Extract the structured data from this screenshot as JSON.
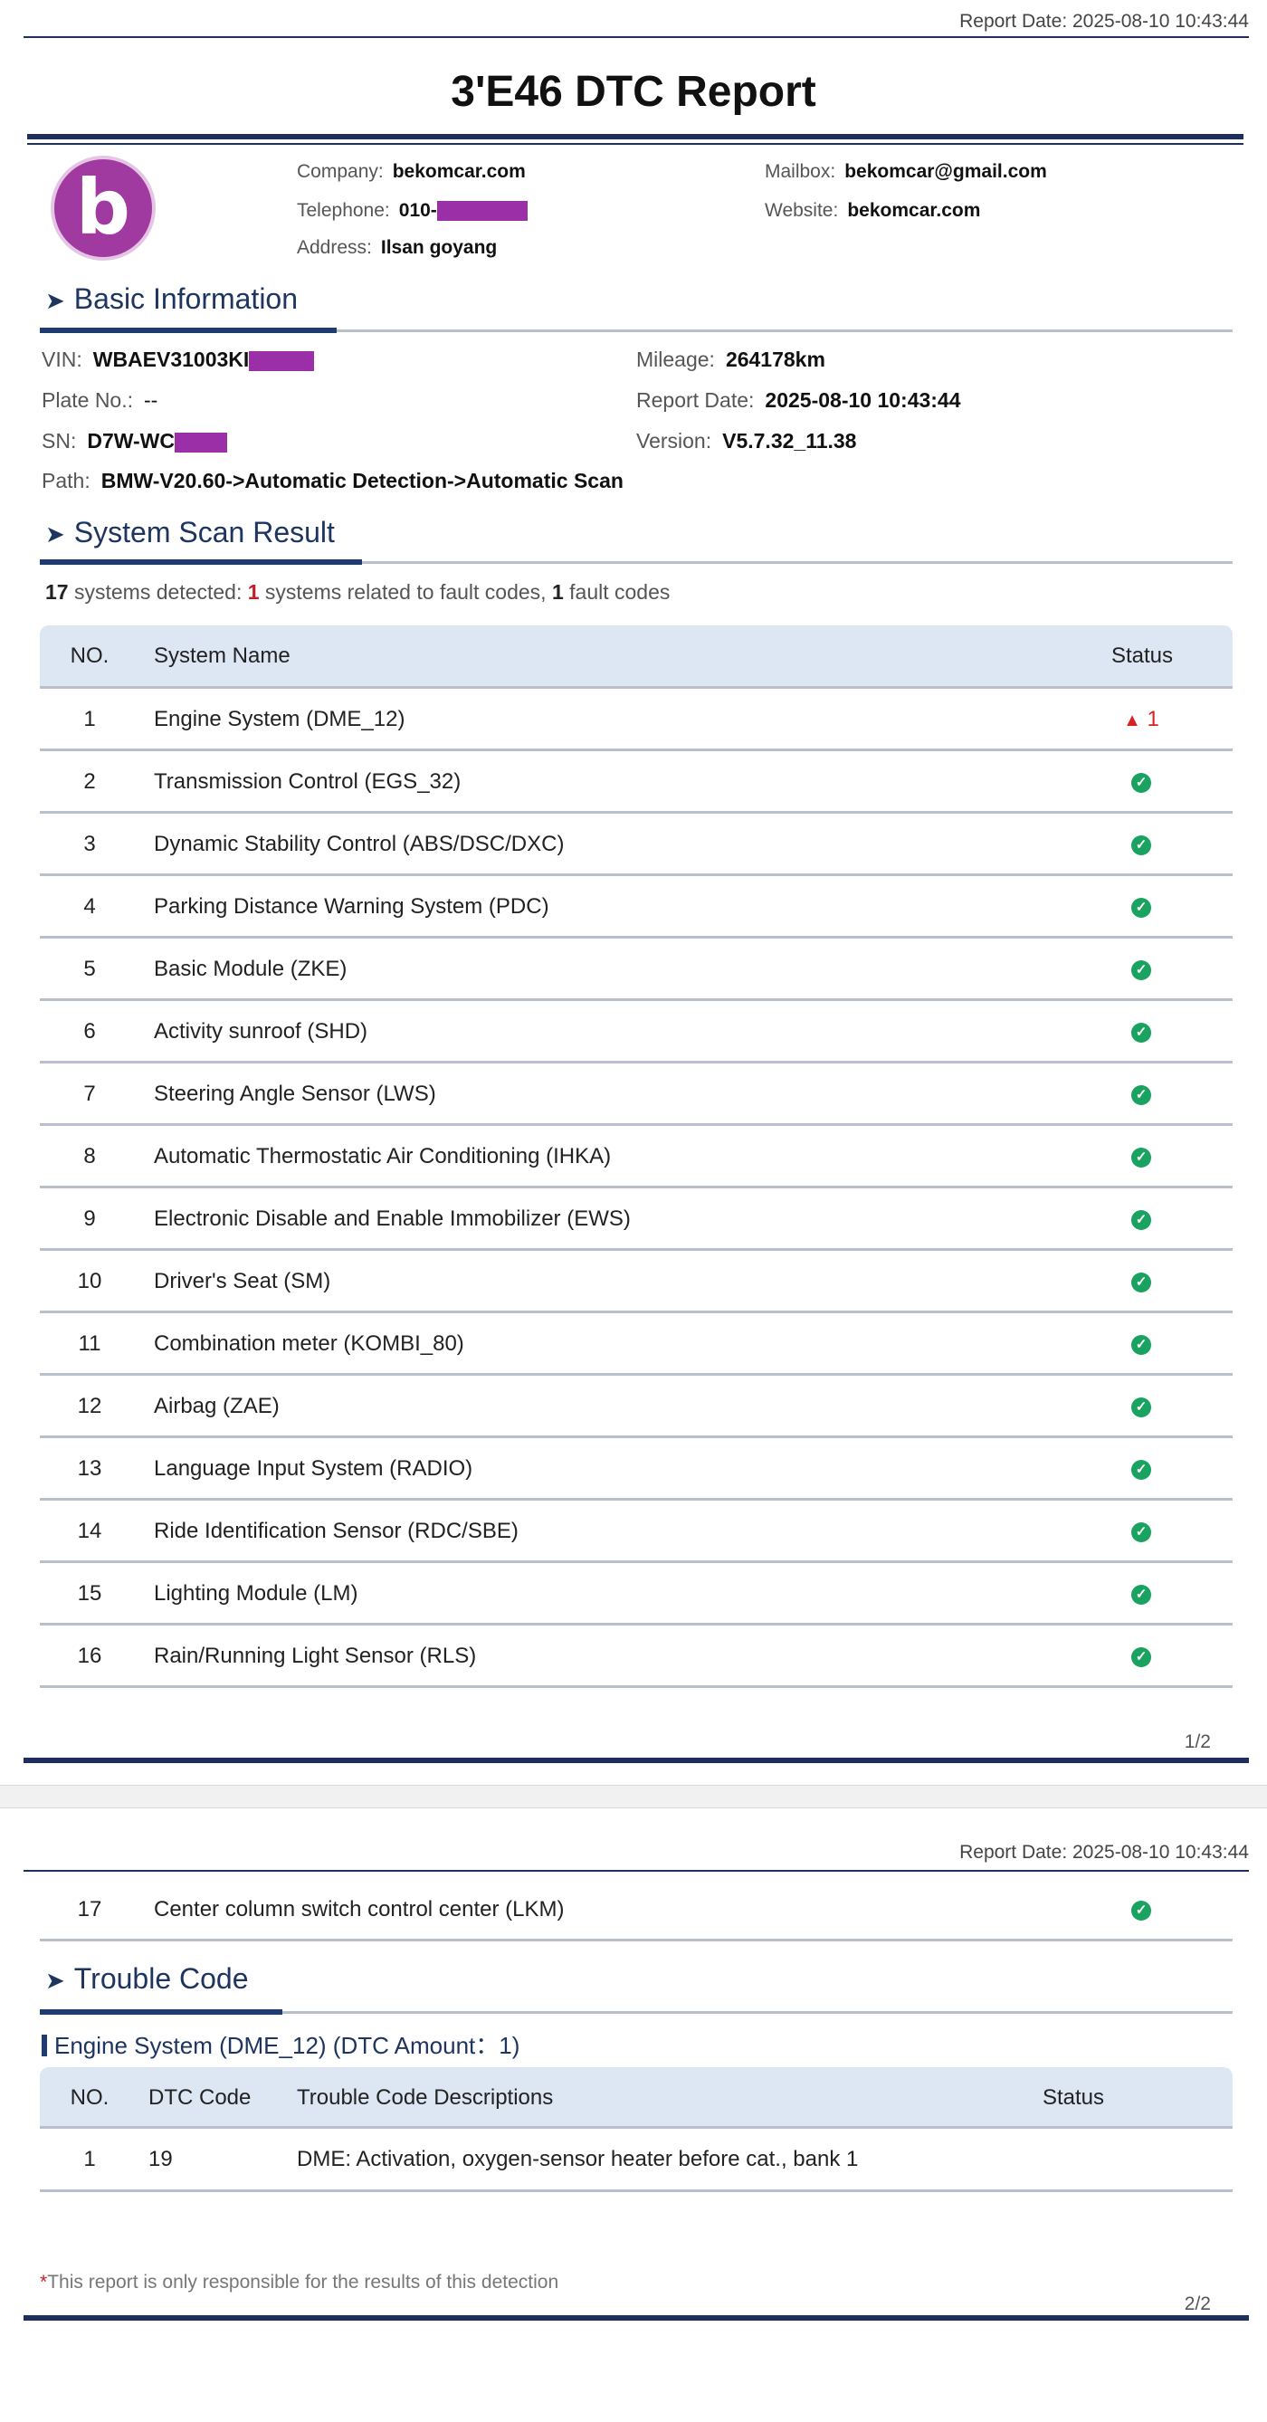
{
  "header": {
    "report_date": "Report Date: 2025-08-10 10:43:44",
    "title": "3'E46  DTC Report"
  },
  "logo": {
    "letter": "b"
  },
  "company": {
    "company_label": "Company:",
    "company_value": "bekomcar.com",
    "telephone_label": "Telephone:",
    "telephone_value": "010-",
    "address_label": "Address:",
    "address_value": "Ilsan goyang",
    "mailbox_label": "Mailbox:",
    "mailbox_value": "bekomcar@gmail.com",
    "website_label": "Website:",
    "website_value": "bekomcar.com",
    "redaction_color": "#9a2fa8"
  },
  "basic": {
    "heading": "Basic Information",
    "vin_label": "VIN:",
    "vin_value": "WBAEV31003KI",
    "plate_label": "Plate No.:",
    "plate_value": "--",
    "sn_label": "SN:",
    "sn_value": "D7W-WC",
    "path_label": "Path:",
    "path_value": "BMW-V20.60->Automatic Detection->Automatic Scan",
    "mileage_label": "Mileage:",
    "mileage_value": "264178km",
    "rdate_label": "Report Date:",
    "rdate_value": "2025-08-10 10:43:44",
    "version_label": "Version:",
    "version_value": "V5.7.32_11.38"
  },
  "scan": {
    "heading": "System Scan Result",
    "summary": {
      "systems_count": "17",
      "systems_text": " systems detected: ",
      "related_count": "1",
      "related_text": " systems related to fault codes, ",
      "fault_count": "1",
      "fault_text": " fault codes"
    },
    "columns": {
      "no": "NO.",
      "name": "System Name",
      "status": "Status"
    },
    "rows": [
      {
        "no": "1",
        "name": "Engine System (DME_12)",
        "status": "fault",
        "count": "1"
      },
      {
        "no": "2",
        "name": "Transmission Control (EGS_32)",
        "status": "ok"
      },
      {
        "no": "3",
        "name": "Dynamic Stability Control (ABS/DSC/DXC)",
        "status": "ok"
      },
      {
        "no": "4",
        "name": "Parking Distance Warning System (PDC)",
        "status": "ok"
      },
      {
        "no": "5",
        "name": "Basic Module (ZKE)",
        "status": "ok"
      },
      {
        "no": "6",
        "name": "Activity sunroof (SHD)",
        "status": "ok"
      },
      {
        "no": "7",
        "name": "Steering Angle Sensor (LWS)",
        "status": "ok"
      },
      {
        "no": "8",
        "name": "Automatic Thermostatic Air Conditioning (IHKA)",
        "status": "ok"
      },
      {
        "no": "9",
        "name": "Electronic Disable and Enable Immobilizer (EWS)",
        "status": "ok"
      },
      {
        "no": "10",
        "name": "Driver's Seat (SM)",
        "status": "ok"
      },
      {
        "no": "11",
        "name": "Combination meter (KOMBI_80)",
        "status": "ok"
      },
      {
        "no": "12",
        "name": "Airbag (ZAE)",
        "status": "ok"
      },
      {
        "no": "13",
        "name": "Language Input System (RADIO)",
        "status": "ok"
      },
      {
        "no": "14",
        "name": "Ride Identification Sensor (RDC/SBE)",
        "status": "ok"
      },
      {
        "no": "15",
        "name": "Lighting Module (LM)",
        "status": "ok"
      },
      {
        "no": "16",
        "name": "Rain/Running Light Sensor (RLS)",
        "status": "ok"
      }
    ],
    "row17": {
      "no": "17",
      "name": "Center column switch control center (LKM)",
      "status": "ok"
    },
    "ok_icon": "check-circle-icon",
    "fault_icon": "warning-triangle-icon",
    "ok_color": "#1aa260",
    "fault_color": "#d42424"
  },
  "page1": {
    "number": "1/2"
  },
  "page2": {
    "report_date": "Report Date: 2025-08-10 10:43:44",
    "number": "2/2"
  },
  "trouble": {
    "heading": "Trouble Code",
    "subheading": "Engine System (DME_12) (DTC Amount：1)",
    "columns": {
      "no": "NO.",
      "code": "DTC Code",
      "desc": "Trouble Code Descriptions",
      "status": "Status"
    },
    "rows": [
      {
        "no": "1",
        "code": "19",
        "desc": "DME: Activation, oxygen-sensor heater before cat., bank 1",
        "status": ""
      }
    ]
  },
  "footer": {
    "asterisk": "*",
    "note": "This report is only responsible for the results of this detection"
  },
  "theme": {
    "navy": "#1e2f5c",
    "header_bg": "#dde6f3"
  }
}
